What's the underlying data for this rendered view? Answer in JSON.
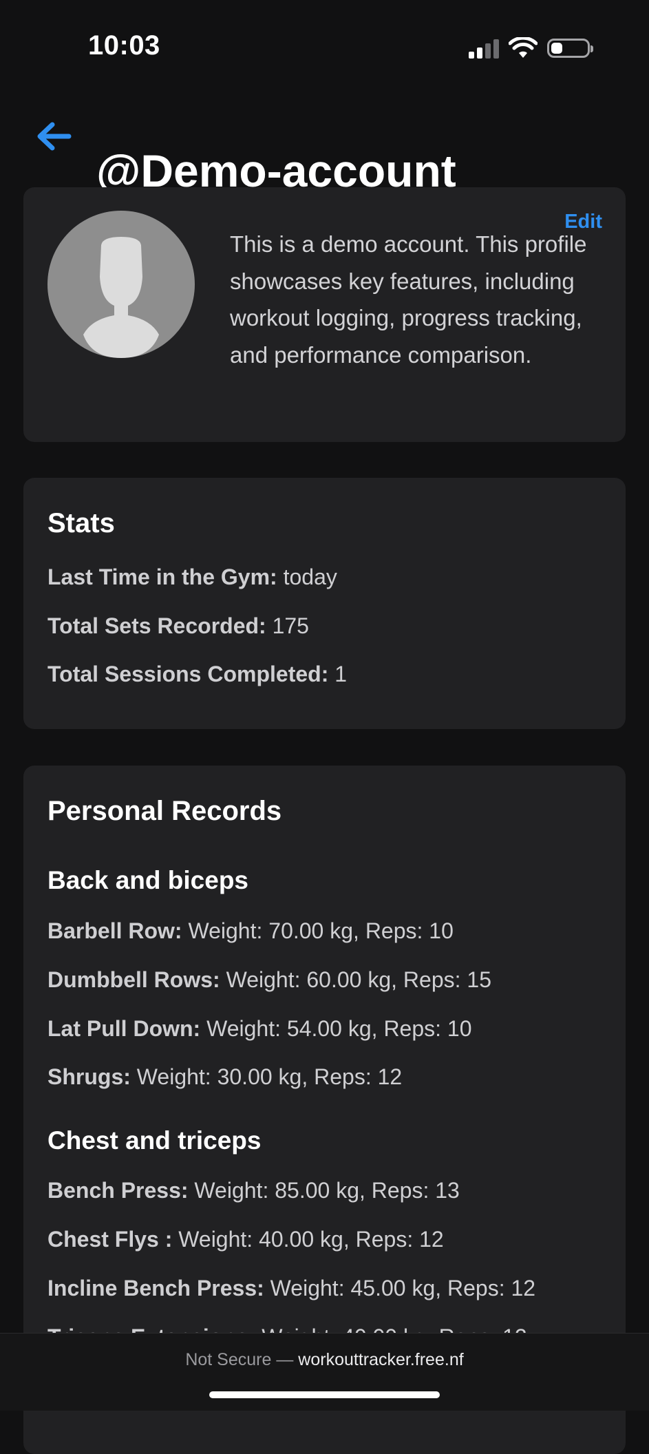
{
  "status_bar": {
    "time": "10:03",
    "icons": [
      "cellular-signal-icon",
      "wifi-icon",
      "battery-icon"
    ]
  },
  "header": {
    "back_icon": "arrow-left-icon",
    "title": "@Demo-account"
  },
  "profile": {
    "avatar_icon": "default-avatar-icon",
    "edit_label": "Edit",
    "bio": "This is a demo account. This profile showcases key features, including workout logging, progress tracking, and performance comparison."
  },
  "stats": {
    "title": "Stats",
    "items": [
      {
        "label": "Last Time in the Gym:",
        "value": "today"
      },
      {
        "label": "Total Sets Recorded:",
        "value": "175"
      },
      {
        "label": "Total Sessions Completed:",
        "value": "1"
      }
    ]
  },
  "personal_records": {
    "title": "Personal Records",
    "sections": [
      {
        "title": "Back and biceps",
        "records": [
          {
            "exercise": "Barbell Row:",
            "detail": "Weight: 70.00 kg, Reps: 10"
          },
          {
            "exercise": "Dumbbell Rows:",
            "detail": "Weight: 60.00 kg, Reps: 15"
          },
          {
            "exercise": "Lat Pull Down:",
            "detail": "Weight: 54.00 kg, Reps: 10"
          },
          {
            "exercise": "Shrugs:",
            "detail": "Weight: 30.00 kg, Reps: 12"
          }
        ]
      },
      {
        "title": "Chest and triceps",
        "records": [
          {
            "exercise": "Bench Press:",
            "detail": "Weight: 85.00 kg, Reps: 13"
          },
          {
            "exercise": "Chest Flys :",
            "detail": "Weight: 40.00 kg, Reps: 12"
          },
          {
            "exercise": "Incline Bench Press:",
            "detail": "Weight: 45.00 kg, Reps: 12"
          },
          {
            "exercise": "Triceps Extensions:",
            "detail": "Weight: 40.00 kg, Reps: 12"
          }
        ]
      }
    ]
  },
  "browser": {
    "security_label": "Not Secure —",
    "domain": "workouttracker.free.nf"
  },
  "colors": {
    "background": "#111112",
    "card": "#212123",
    "accent": "#2f8ff0",
    "text": "#ffffff",
    "muted_text": "#d0d0d3"
  }
}
